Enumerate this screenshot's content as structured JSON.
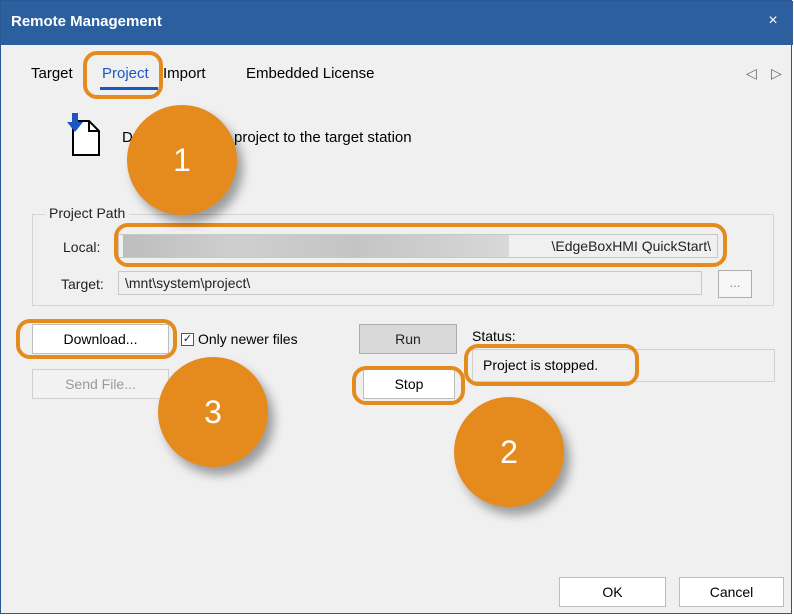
{
  "window": {
    "title": "Remote Management",
    "close_glyph": "×"
  },
  "tabs": {
    "items": [
      "Target",
      "Project",
      "Import",
      "Embedded License"
    ],
    "active": "Project",
    "prev_glyph": "◁",
    "next_glyph": "▷"
  },
  "heading": {
    "text_left": "D",
    "text_right": "project to the target station",
    "icon": "download-document-icon"
  },
  "project_path": {
    "group_title": "Project Path",
    "local_label": "Local:",
    "local_value_visible": "\\EdgeBoxHMI QuickStart\\",
    "target_label": "Target:",
    "target_value": "\\mnt\\system\\project\\",
    "browse_label": "..."
  },
  "actions": {
    "download_label": "Download...",
    "send_file_label": "Send File...",
    "only_newer_label": "Only newer files",
    "only_newer_checked": true,
    "checkbox_glyph": "✓",
    "run_label": "Run",
    "stop_label": "Stop"
  },
  "status": {
    "label": "Status:",
    "value": "Project is stopped."
  },
  "footer": {
    "ok_label": "OK",
    "cancel_label": "Cancel"
  },
  "annotations": {
    "callout_1": "1",
    "callout_2": "2",
    "callout_3": "3",
    "accent_color": "#e58a1d"
  },
  "colors": {
    "titlebar": "#2c5f9e",
    "active_tab": "#1a56c4",
    "dialog_bg": "#f0f0f0"
  }
}
